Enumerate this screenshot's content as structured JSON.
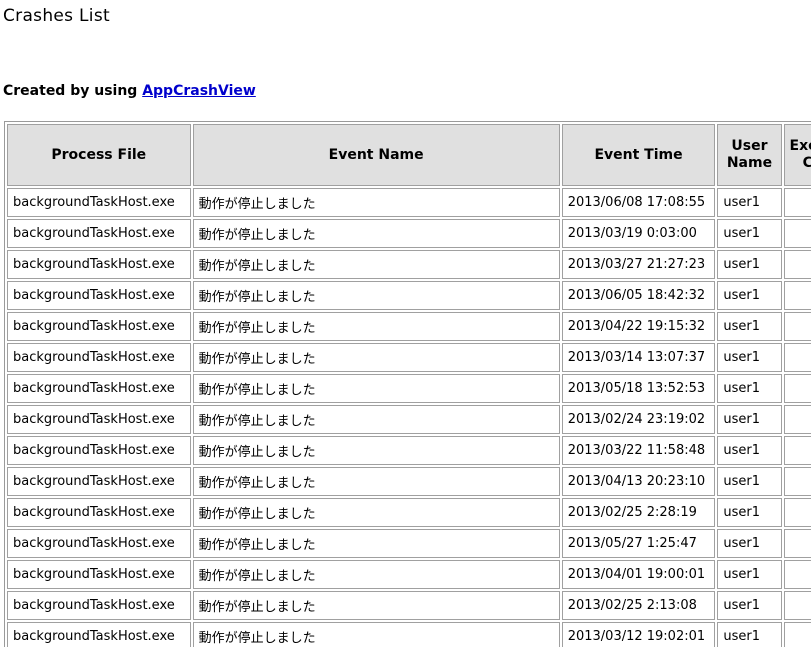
{
  "page": {
    "title": "Crashes List",
    "created_prefix": "Created by using ",
    "created_link": "AppCrashView"
  },
  "table": {
    "headers": {
      "process_file": "Process File",
      "event_name": "Event Name",
      "event_time": "Event Time",
      "user_name": "User Name",
      "exception_code": "Exception Code"
    },
    "rows": [
      {
        "process_file": "backgroundTaskHost.exe",
        "event_name": "動作が停止しました",
        "event_time": "2013/06/08 17:08:55",
        "user_name": "user1",
        "exception_code": ""
      },
      {
        "process_file": "backgroundTaskHost.exe",
        "event_name": "動作が停止しました",
        "event_time": "2013/03/19 0:03:00",
        "user_name": "user1",
        "exception_code": ""
      },
      {
        "process_file": "backgroundTaskHost.exe",
        "event_name": "動作が停止しました",
        "event_time": "2013/03/27 21:27:23",
        "user_name": "user1",
        "exception_code": ""
      },
      {
        "process_file": "backgroundTaskHost.exe",
        "event_name": "動作が停止しました",
        "event_time": "2013/06/05 18:42:32",
        "user_name": "user1",
        "exception_code": ""
      },
      {
        "process_file": "backgroundTaskHost.exe",
        "event_name": "動作が停止しました",
        "event_time": "2013/04/22 19:15:32",
        "user_name": "user1",
        "exception_code": ""
      },
      {
        "process_file": "backgroundTaskHost.exe",
        "event_name": "動作が停止しました",
        "event_time": "2013/03/14 13:07:37",
        "user_name": "user1",
        "exception_code": ""
      },
      {
        "process_file": "backgroundTaskHost.exe",
        "event_name": "動作が停止しました",
        "event_time": "2013/05/18 13:52:53",
        "user_name": "user1",
        "exception_code": ""
      },
      {
        "process_file": "backgroundTaskHost.exe",
        "event_name": "動作が停止しました",
        "event_time": "2013/02/24 23:19:02",
        "user_name": "user1",
        "exception_code": ""
      },
      {
        "process_file": "backgroundTaskHost.exe",
        "event_name": "動作が停止しました",
        "event_time": "2013/03/22 11:58:48",
        "user_name": "user1",
        "exception_code": ""
      },
      {
        "process_file": "backgroundTaskHost.exe",
        "event_name": "動作が停止しました",
        "event_time": "2013/04/13 20:23:10",
        "user_name": "user1",
        "exception_code": ""
      },
      {
        "process_file": "backgroundTaskHost.exe",
        "event_name": "動作が停止しました",
        "event_time": "2013/02/25 2:28:19",
        "user_name": "user1",
        "exception_code": ""
      },
      {
        "process_file": "backgroundTaskHost.exe",
        "event_name": "動作が停止しました",
        "event_time": "2013/05/27 1:25:47",
        "user_name": "user1",
        "exception_code": ""
      },
      {
        "process_file": "backgroundTaskHost.exe",
        "event_name": "動作が停止しました",
        "event_time": "2013/04/01 19:00:01",
        "user_name": "user1",
        "exception_code": ""
      },
      {
        "process_file": "backgroundTaskHost.exe",
        "event_name": "動作が停止しました",
        "event_time": "2013/02/25 2:13:08",
        "user_name": "user1",
        "exception_code": ""
      },
      {
        "process_file": "backgroundTaskHost.exe",
        "event_name": "動作が停止しました",
        "event_time": "2013/03/12 19:02:01",
        "user_name": "user1",
        "exception_code": ""
      }
    ]
  }
}
